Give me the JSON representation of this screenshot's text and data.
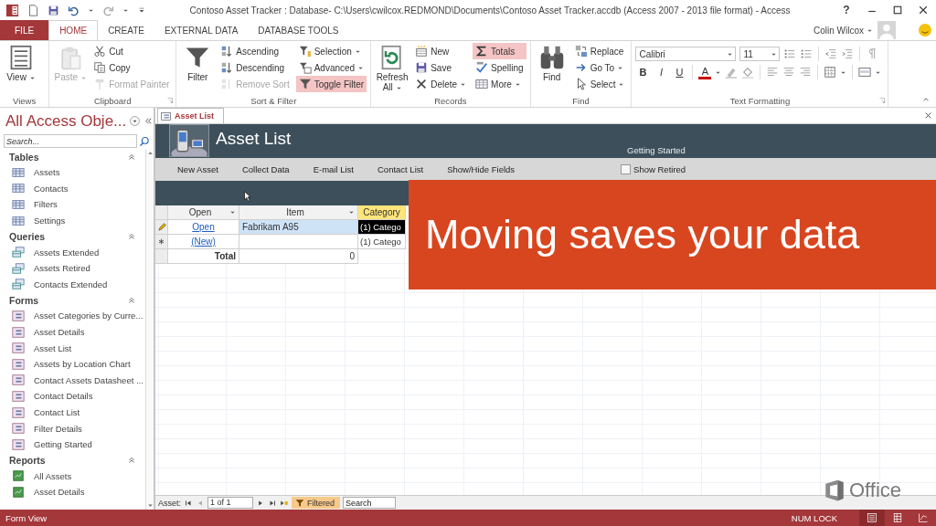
{
  "window": {
    "title": "Contoso Asset Tracker : Database- C:\\Users\\cwilcox.REDMOND\\Documents\\Contoso Asset Tracker.accdb (Access 2007 - 2013 file format) - Access",
    "help": "?"
  },
  "ribbon_tabs": [
    {
      "label": "FILE",
      "kind": "file",
      "selected": false
    },
    {
      "label": "HOME",
      "kind": "tab",
      "selected": true
    },
    {
      "label": "CREATE",
      "kind": "tab",
      "selected": false
    },
    {
      "label": "EXTERNAL DATA",
      "kind": "tab",
      "selected": false
    },
    {
      "label": "DATABASE TOOLS",
      "kind": "tab",
      "selected": false
    }
  ],
  "account": {
    "user": "Colin Wilcox"
  },
  "ribbon_groups": [
    {
      "label": "Views",
      "kind": "buttons",
      "items": [
        {
          "label": "View",
          "kind": "large",
          "disabled": false,
          "on": false,
          "dropdown": true
        }
      ]
    },
    {
      "label": "Clipboard",
      "kind": "buttons",
      "launcher": true,
      "items": [
        {
          "label": "Paste",
          "kind": "large",
          "disabled": true,
          "on": false,
          "dropdown": true
        },
        {
          "label": "Cut",
          "kind": "small",
          "disabled": false,
          "on": false,
          "dropdown": false
        },
        {
          "label": "Copy",
          "kind": "small",
          "disabled": false,
          "on": false,
          "dropdown": false
        },
        {
          "label": "Format Painter",
          "kind": "small",
          "disabled": true,
          "on": false,
          "dropdown": false
        }
      ]
    },
    {
      "label": "Sort & Filter",
      "kind": "buttons",
      "items": [
        {
          "label": "Filter",
          "kind": "large",
          "disabled": false,
          "on": false,
          "dropdown": false
        },
        {
          "label": "Ascending",
          "kind": "small",
          "disabled": false,
          "on": false,
          "dropdown": false
        },
        {
          "label": "Descending",
          "kind": "small",
          "disabled": false,
          "on": false,
          "dropdown": false
        },
        {
          "label": "Remove Sort",
          "kind": "small",
          "disabled": true,
          "on": false,
          "dropdown": false
        },
        {
          "label": "Selection",
          "kind": "small",
          "disabled": false,
          "on": false,
          "dropdown": true
        },
        {
          "label": "Advanced",
          "kind": "small",
          "disabled": false,
          "on": false,
          "dropdown": true
        },
        {
          "label": "Toggle Filter",
          "kind": "small",
          "disabled": false,
          "on": true,
          "dropdown": false
        }
      ]
    },
    {
      "label": "Records",
      "kind": "buttons",
      "items": [
        {
          "label": "Refresh All",
          "kind": "large",
          "disabled": false,
          "on": false,
          "dropdown": true
        },
        {
          "label": "New",
          "kind": "small",
          "disabled": false,
          "on": false,
          "dropdown": false
        },
        {
          "label": "Save",
          "kind": "small",
          "disabled": false,
          "on": false,
          "dropdown": false
        },
        {
          "label": "Delete",
          "kind": "small",
          "disabled": false,
          "on": false,
          "dropdown": true
        },
        {
          "label": "Totals",
          "kind": "small",
          "disabled": false,
          "on": true,
          "dropdown": false
        },
        {
          "label": "Spelling",
          "kind": "small",
          "disabled": false,
          "on": false,
          "dropdown": false
        },
        {
          "label": "More",
          "kind": "small",
          "disabled": false,
          "on": false,
          "dropdown": true
        }
      ]
    },
    {
      "label": "Find",
      "kind": "buttons",
      "items": [
        {
          "label": "Find",
          "kind": "large",
          "disabled": false,
          "on": false,
          "dropdown": false
        },
        {
          "label": "Replace",
          "kind": "small",
          "disabled": false,
          "on": false,
          "dropdown": false
        },
        {
          "label": "Go To",
          "kind": "small",
          "disabled": false,
          "on": false,
          "dropdown": true
        },
        {
          "label": "Select",
          "kind": "small",
          "disabled": false,
          "on": false,
          "dropdown": true
        }
      ]
    },
    {
      "label": "Text Formatting",
      "kind": "format",
      "launcher": true,
      "font": "Calibri",
      "size": "11",
      "styles": [
        "B",
        "I",
        "U"
      ],
      "font_color": "A"
    }
  ],
  "navigation": {
    "title": "All Access Obje...",
    "search_placeholder": "Search...",
    "groups": [
      {
        "label": "Tables",
        "kind": "table",
        "expanded": true,
        "items": [
          "Assets",
          "Contacts",
          "Filters",
          "Settings"
        ]
      },
      {
        "label": "Queries",
        "kind": "query",
        "expanded": true,
        "items": [
          "Assets Extended",
          "Assets Retired",
          "Contacts Extended"
        ]
      },
      {
        "label": "Forms",
        "kind": "form",
        "expanded": true,
        "items": [
          "Asset Categories by Curre...",
          "Asset Details",
          "Asset List",
          "Assets by Location Chart",
          "Contact Assets Datasheet ...",
          "Contact Details",
          "Contact List",
          "Filter Details",
          "Getting Started"
        ]
      },
      {
        "label": "Reports",
        "kind": "report",
        "expanded": true,
        "items": [
          "All Assets",
          "Asset Details"
        ]
      }
    ]
  },
  "document": {
    "tab": "Asset List",
    "form_title": "Asset List",
    "header_link": "Getting Started",
    "commands": [
      "New Asset",
      "Collect Data",
      "E-mail List",
      "Contact List",
      "Show/Hide Fields"
    ],
    "show_retired": {
      "label": "Show Retired",
      "checked": false
    },
    "columns": [
      {
        "label": "Open",
        "selected": false
      },
      {
        "label": "Item",
        "selected": false
      },
      {
        "label": "Category",
        "selected": true
      }
    ],
    "rows": [
      {
        "kind": "edit",
        "selected": true,
        "open": "Open",
        "item": "Fabrikam A95",
        "category": "(1) Catego"
      },
      {
        "kind": "new",
        "selected": false,
        "open": "(New)",
        "category": "(1) Catego"
      }
    ],
    "total": {
      "label": "Total",
      "item": "0"
    },
    "record_nav": {
      "label": "Asset:",
      "position": "1 of 1",
      "filter": "Filtered",
      "search_placeholder": "Search"
    }
  },
  "banner": {
    "caption": "Moving saves your data"
  },
  "logo": {
    "text": "Office"
  },
  "status_bar": {
    "view": "Form View",
    "indicator": "NUM LOCK"
  }
}
